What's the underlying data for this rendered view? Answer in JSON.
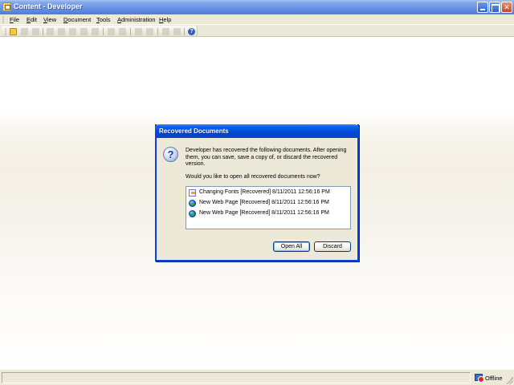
{
  "window": {
    "title": "Content - Developer"
  },
  "menu": [
    "File",
    "Edit",
    "View",
    "Document",
    "Tools",
    "Administration",
    "Help"
  ],
  "toolbar": {
    "buttons": [
      "open-icon",
      "save-icon",
      "print-icon",
      "cut-icon",
      "copy-icon",
      "paste-icon",
      "delete-icon",
      "properties-icon",
      "undo-icon",
      "redo-icon",
      "zoom-in-icon",
      "zoom-out-icon",
      "spell-icon",
      "find-icon",
      "help-icon"
    ],
    "help_glyph": "?"
  },
  "dialog": {
    "title": "Recovered Documents",
    "message": "Developer has recovered the following documents. After opening them, you can save, save a copy of, or discard the recovered version.",
    "question": "Would you like to open all recovered documents now?",
    "documents": [
      {
        "icon": "document-icon",
        "label": "Changing Fonts [Recovered] 8/11/2011 12:56:16 PM"
      },
      {
        "icon": "web-page-icon",
        "label": "New Web Page [Recovered] 8/11/2011 12:56:16 PM"
      },
      {
        "icon": "web-page-icon",
        "label": "New Web Page [Recovered] 8/11/2011 12:56:16 PM"
      }
    ],
    "buttons": {
      "open_all": "Open All",
      "discard": "Discard"
    }
  },
  "status": {
    "connection": "Offline"
  }
}
